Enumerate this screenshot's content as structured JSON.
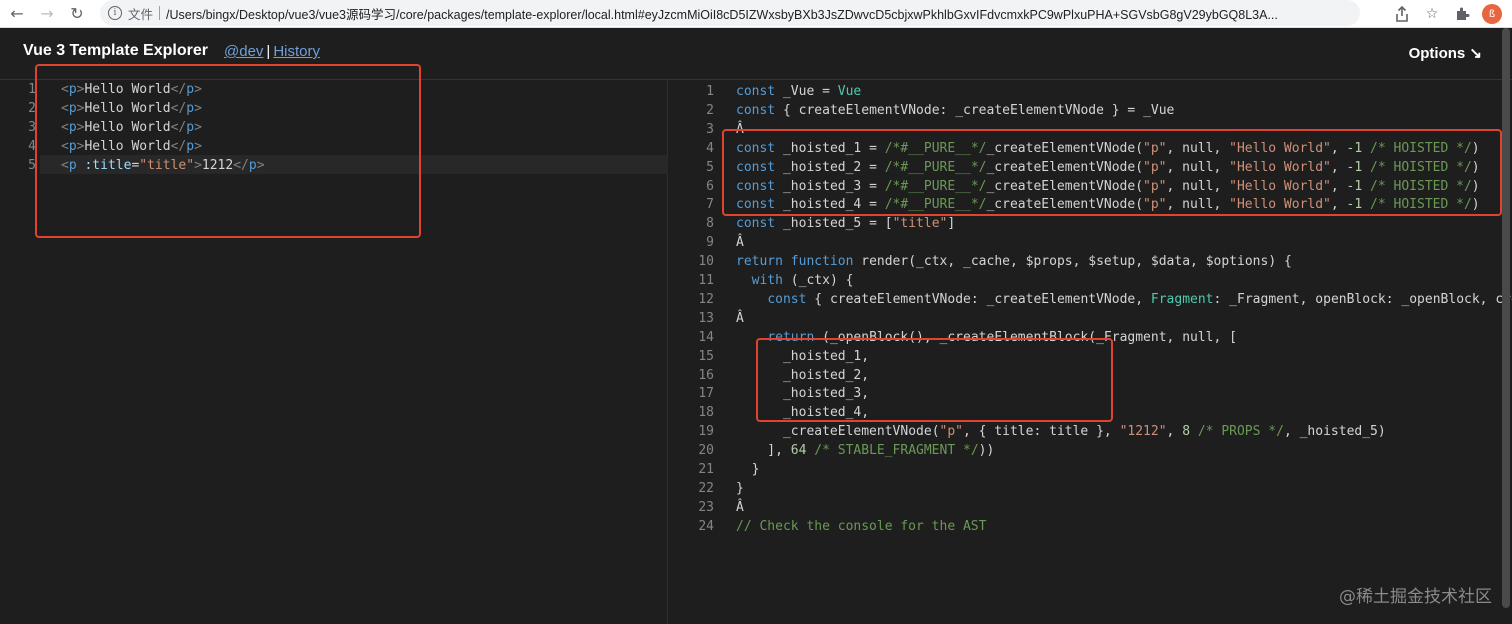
{
  "browser": {
    "back_icon": "←",
    "forward_icon": "→",
    "reload_icon": "↻",
    "scheme_label": "文件",
    "url": "/Users/bingx/Desktop/vue3/vue3源码学习/core/packages/template-explorer/local.html#eyJzcmMiOiI8cD5IZWxsbyBXb3JsZDwvcD5cbjxwPkhlbGxvIFdvcmxkPC9wPlxuPHA+SGVsbG8gV29ybGQ8L3A...",
    "profile_initial": "ß"
  },
  "header": {
    "title": "Vue 3 Template Explorer",
    "dev_link": "@dev",
    "separator": "|",
    "history_link": "History",
    "options_label": "Options ↘"
  },
  "left_editor": {
    "lines": [
      {
        "n": "1",
        "text": "<p>Hello World</p>"
      },
      {
        "n": "2",
        "text": "<p>Hello World</p>"
      },
      {
        "n": "3",
        "text": "<p>Hello World</p>"
      },
      {
        "n": "4",
        "text": "<p>Hello World</p>"
      },
      {
        "n": "5",
        "text": "<p :title=\"title\">1212</p>"
      }
    ]
  },
  "right_editor": {
    "lines": [
      {
        "n": "1",
        "text": "const _Vue = Vue"
      },
      {
        "n": "2",
        "text": "const { createElementVNode: _createElementVNode } = _Vue"
      },
      {
        "n": "3",
        "text": "Â"
      },
      {
        "n": "4",
        "text": "const _hoisted_1 = /*#__PURE__*/_createElementVNode(\"p\", null, \"Hello World\", -1 /* HOISTED */)"
      },
      {
        "n": "5",
        "text": "const _hoisted_2 = /*#__PURE__*/_createElementVNode(\"p\", null, \"Hello World\", -1 /* HOISTED */)"
      },
      {
        "n": "6",
        "text": "const _hoisted_3 = /*#__PURE__*/_createElementVNode(\"p\", null, \"Hello World\", -1 /* HOISTED */)"
      },
      {
        "n": "7",
        "text": "const _hoisted_4 = /*#__PURE__*/_createElementVNode(\"p\", null, \"Hello World\", -1 /* HOISTED */)"
      },
      {
        "n": "8",
        "text": "const _hoisted_5 = [\"title\"]"
      },
      {
        "n": "9",
        "text": "Â"
      },
      {
        "n": "10",
        "text": "return function render(_ctx, _cache, $props, $setup, $data, $options) {"
      },
      {
        "n": "11",
        "text": "  with (_ctx) {"
      },
      {
        "n": "12",
        "text": "    const { createElementVNode: _createElementVNode, Fragment: _Fragment, openBlock: _openBlock, crea"
      },
      {
        "n": "13",
        "text": "Â"
      },
      {
        "n": "14",
        "text": "    return (_openBlock(), _createElementBlock(_Fragment, null, ["
      },
      {
        "n": "15",
        "text": "      _hoisted_1,"
      },
      {
        "n": "16",
        "text": "      _hoisted_2,"
      },
      {
        "n": "17",
        "text": "      _hoisted_3,"
      },
      {
        "n": "18",
        "text": "      _hoisted_4,"
      },
      {
        "n": "19",
        "text": "      _createElementVNode(\"p\", { title: title }, \"1212\", 8 /* PROPS */, _hoisted_5)"
      },
      {
        "n": "20",
        "text": "    ], 64 /* STABLE_FRAGMENT */))"
      },
      {
        "n": "21",
        "text": "  }"
      },
      {
        "n": "22",
        "text": "}"
      },
      {
        "n": "23",
        "text": "Â"
      },
      {
        "n": "24",
        "text": "// Check the console for the AST"
      }
    ]
  },
  "watermark": "@稀土掘金技术社区",
  "colors": {
    "annotation_red": "#e0432f",
    "link_blue": "#6fa0d8"
  }
}
